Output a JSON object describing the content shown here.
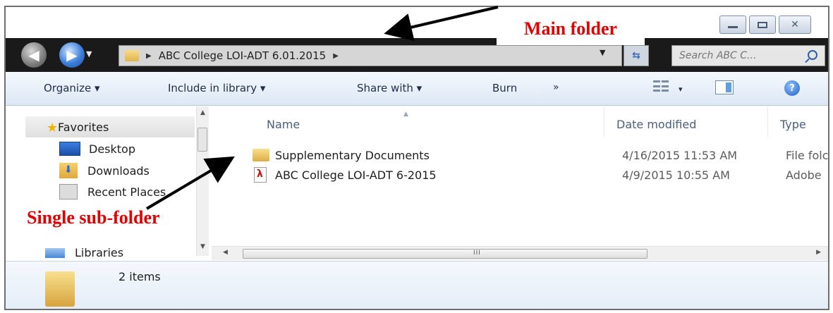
{
  "window": {
    "controls": {
      "minimize": "▭",
      "maximize": "▢",
      "close": "✕"
    }
  },
  "address": {
    "path": "ABC College LOI-ADT 6.01.2015",
    "separator": "▶"
  },
  "search": {
    "placeholder": "Search ABC C..."
  },
  "annotations": {
    "main_folder": "Main folder",
    "single_subfolder": "Single sub-folder"
  },
  "toolbar": {
    "organize": "Organize ▾",
    "include_in_library": "Include in library ▾",
    "share_with": "Share with ▾",
    "burn": "Burn",
    "more": "»",
    "views_dropdown": "▾",
    "help": "?"
  },
  "nav_pane": {
    "favorites": "Favorites",
    "items": [
      "Desktop",
      "Downloads",
      "Recent Places"
    ],
    "libraries": "Libraries"
  },
  "file_list": {
    "columns": {
      "name": "Name",
      "date_modified": "Date modified",
      "type": "Type"
    },
    "rows": [
      {
        "name": "Supplementary Documents",
        "date": "4/16/2015 11:53 AM",
        "type": "File folc",
        "icon": "folder-icon"
      },
      {
        "name": "ABC College LOI-ADT 6-2015",
        "date": "4/9/2015 10:55 AM",
        "type": "Adobe",
        "icon": "pdf-icon"
      }
    ]
  },
  "scrollbar": {
    "grip": "III"
  },
  "details": {
    "item_count": "2 items"
  },
  "colors": {
    "annotation_red": "#e00000",
    "address_background": "#1a1a1a",
    "toolbar_text": "#1f2d4a"
  }
}
